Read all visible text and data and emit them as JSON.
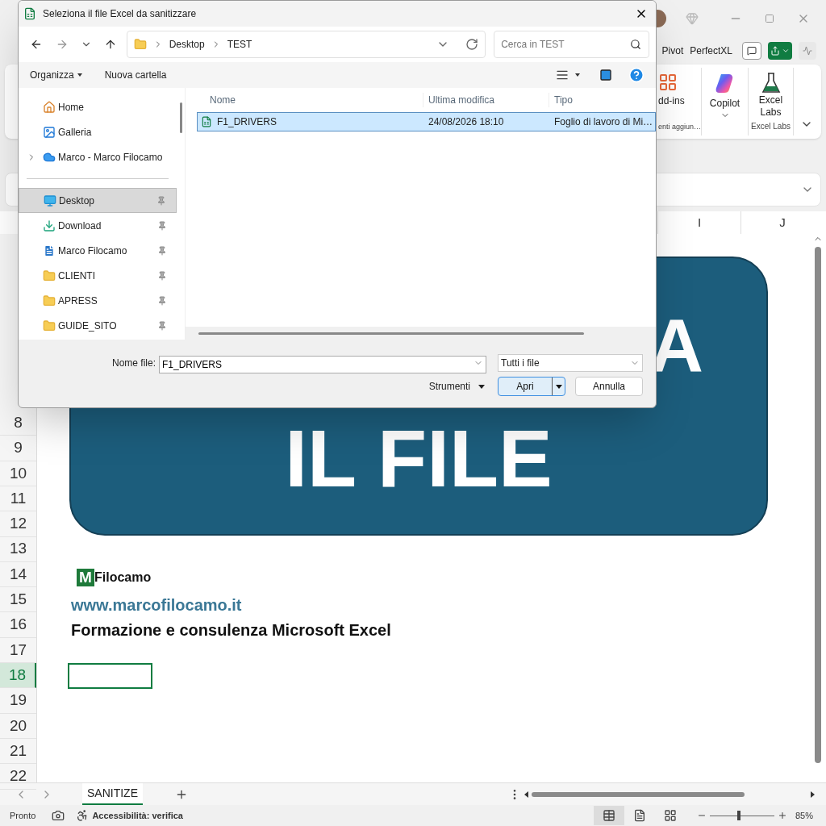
{
  "excel": {
    "ribbon_tabs": [
      "Pivot",
      "PerfectXL"
    ],
    "ribbon_groups": [
      {
        "kind": "addins",
        "label": "enti aggiun…",
        "button": "dd-ins"
      },
      {
        "kind": "copilot",
        "button": "Copilot"
      },
      {
        "kind": "labs",
        "label": "Excel Labs",
        "button": "Excel Labs"
      }
    ],
    "columns": [
      "I",
      "J"
    ],
    "rows": [
      {
        "label": "8",
        "selected": false
      },
      {
        "label": "9",
        "selected": false
      },
      {
        "label": "10",
        "selected": false
      },
      {
        "label": "11",
        "selected": false
      },
      {
        "label": "12",
        "selected": false
      },
      {
        "label": "13",
        "selected": false
      },
      {
        "label": "14",
        "selected": false
      },
      {
        "label": "15",
        "selected": false
      },
      {
        "label": "16",
        "selected": false
      },
      {
        "label": "17",
        "selected": false
      },
      {
        "label": "18",
        "selected": true
      },
      {
        "label": "19",
        "selected": false
      },
      {
        "label": "20",
        "selected": false
      },
      {
        "label": "21",
        "selected": false
      },
      {
        "label": "22",
        "selected": false
      }
    ],
    "banner": {
      "lines": [
        "A",
        "IL FILE"
      ]
    },
    "logo": {
      "mark": "M",
      "name": "Filocamo"
    },
    "link": "www.marcofilocamo.it",
    "tagline": "Formazione e consulenza Microsoft Excel",
    "sheet_tabs": [
      {
        "label": "SANITIZE",
        "selected": true
      }
    ],
    "status": {
      "state": "Pronto",
      "accessibility": "Accessibilità: verifica",
      "views": [
        {
          "kind": "normal",
          "selected": true
        },
        {
          "kind": "layout",
          "selected": false
        },
        {
          "kind": "break",
          "selected": false
        }
      ],
      "zoom": {
        "level": 0.45,
        "reading": "85%"
      }
    }
  },
  "dialog": {
    "title": "Seleziona il file Excel da sanitizzare",
    "path": [
      "Desktop",
      "TEST"
    ],
    "search": {
      "placeholder": "Cerca in TEST"
    },
    "toolbar": [
      "Organizza",
      "Nuova cartella"
    ],
    "nav": [
      {
        "kind": "home",
        "label": "Home",
        "selected": false
      },
      {
        "kind": "gallery",
        "label": "Galleria",
        "selected": false
      },
      {
        "kind": "cloud",
        "label": "Marco - Marco Filocamo",
        "selected": false,
        "expanded": false
      },
      {
        "kind": "divider"
      },
      {
        "kind": "desktop",
        "label": "Desktop",
        "selected": true,
        "pinned": true
      },
      {
        "kind": "download",
        "label": "Download",
        "selected": false,
        "pinned": true
      },
      {
        "kind": "doc",
        "label": "Marco Filocamo",
        "selected": false,
        "pinned": true
      },
      {
        "kind": "folder",
        "label": "CLIENTI",
        "selected": false,
        "pinned": true
      },
      {
        "kind": "folder",
        "label": "APRESS",
        "selected": false,
        "pinned": true
      },
      {
        "kind": "folder",
        "label": "GUIDE_SITO",
        "selected": false,
        "pinned": true
      }
    ],
    "columns": [
      "Nome",
      "Ultima modifica",
      "Tipo"
    ],
    "files": [
      {
        "name": "F1_DRIVERS",
        "modified": "24/08/2026 18:10",
        "type": "Foglio di lavoro di Mi…",
        "selected": true
      }
    ],
    "filename_label": "Nome file:",
    "filename": "F1_DRIVERS",
    "filter": "Tutti i file",
    "tools": "Strumenti",
    "buttons": [
      "Apri",
      "Annulla"
    ]
  }
}
